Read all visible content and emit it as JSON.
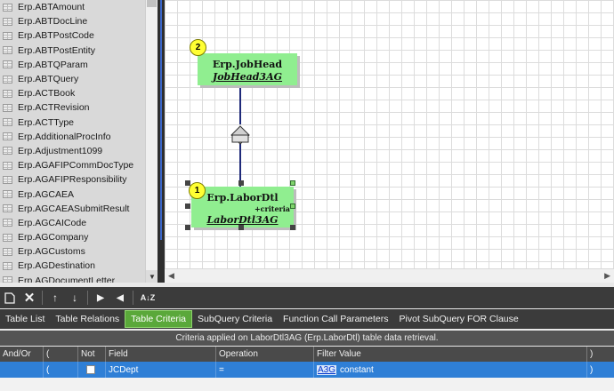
{
  "table_list": {
    "items": [
      "Erp.ABTAmount",
      "Erp.ABTDocLine",
      "Erp.ABTPostCode",
      "Erp.ABTPostEntity",
      "Erp.ABTQParam",
      "Erp.ABTQuery",
      "Erp.ACTBook",
      "Erp.ACTRevision",
      "Erp.ACTType",
      "Erp.AdditionalProcInfo",
      "Erp.Adjustment1099",
      "Erp.AGAFIPCommDocType",
      "Erp.AGAFIPResponsibility",
      "Erp.AGCAEA",
      "Erp.AGCAEASubmitResult",
      "Erp.AGCAICode",
      "Erp.AGCompany",
      "Erp.AGCustoms",
      "Erp.AGDestination",
      "Erp.AGDocumentLetter"
    ]
  },
  "diagram": {
    "entities": [
      {
        "badge": "2",
        "name": "Erp.JobHead",
        "alias": "JobHead3AG"
      },
      {
        "badge": "1",
        "name": "Erp.LaborDtl",
        "alias": "LaborDtl3AG",
        "criteria": "+criteria"
      }
    ]
  },
  "toolbar": {
    "icons": [
      "new-icon",
      "delete-icon",
      "move-up-icon",
      "move-down-icon",
      "play-icon",
      "back-icon",
      "sort-icon"
    ],
    "sort_glyph": "A↓Z"
  },
  "tabs": [
    {
      "label": "Table List",
      "active": false
    },
    {
      "label": "Table Relations",
      "active": false
    },
    {
      "label": "Table Criteria",
      "active": true
    },
    {
      "label": "SubQuery Criteria",
      "active": false
    },
    {
      "label": "Function Call Parameters",
      "active": false
    },
    {
      "label": "Pivot SubQuery FOR Clause",
      "active": false
    }
  ],
  "criteria_info": "Criteria applied on LaborDtl3AG (Erp.LaborDtl) table data retrieval.",
  "grid": {
    "columns": [
      "And/Or",
      "(",
      "Not",
      "Field",
      "Operation",
      "Filter Value",
      ")"
    ],
    "rows": [
      {
        "andor": "",
        "open": "(",
        "not": false,
        "field": "JCDept",
        "operation": "=",
        "value_link": "A3G",
        "value_text": "constant",
        "close": ")"
      }
    ]
  },
  "colors": {
    "entity_fill": "#90ee90",
    "active_tab": "#5aa83a",
    "selected_row": "#2f7fd6",
    "badge": "#ffff33"
  }
}
